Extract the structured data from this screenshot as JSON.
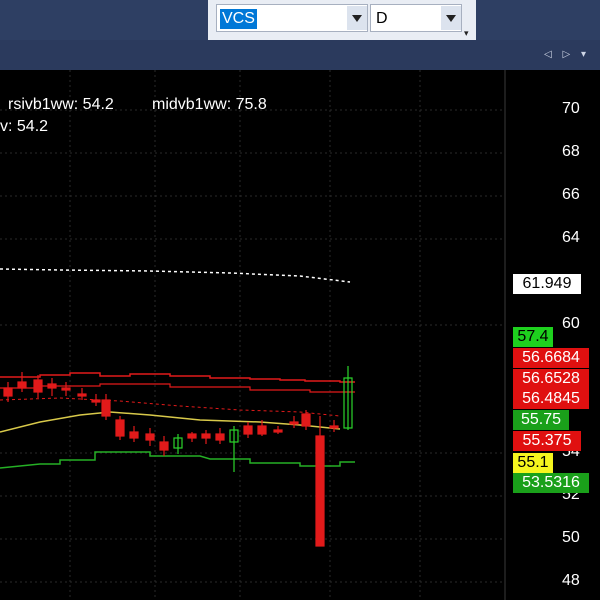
{
  "toolbar": {
    "symbol": "VCS",
    "interval": "D",
    "overflow_icon": "chevron-down-icon"
  },
  "panel": {
    "controls": "◁ ▷ ▾"
  },
  "legend": {
    "rsi": "rsivb1ww: 54.2",
    "mid": "midvb1ww: 75.8",
    "cut": "v: 54.2"
  },
  "axis": {
    "ticks": [
      "70",
      "68",
      "66",
      "64",
      "60",
      "54",
      "52",
      "50",
      "48"
    ]
  },
  "price_tags": [
    {
      "label": "61.949",
      "bg": "#ffffff",
      "fg": "#000000"
    },
    {
      "label": "57.4",
      "bg": "#1ed01e",
      "fg": "#000000"
    },
    {
      "label": "56.6684",
      "bg": "#e01010",
      "fg": "#ffffff"
    },
    {
      "label": "56.6528",
      "bg": "#e01010",
      "fg": "#ffffff"
    },
    {
      "label": "56.4845",
      "bg": "#e01010",
      "fg": "#ffffff"
    },
    {
      "label": "55.75",
      "bg": "#1aa01a",
      "fg": "#ffffff"
    },
    {
      "label": "55.375",
      "bg": "#e01010",
      "fg": "#ffffff"
    },
    {
      "label": "55.1",
      "bg": "#f5f51e",
      "fg": "#000000"
    },
    {
      "label": "53.5316",
      "bg": "#1aa01a",
      "fg": "#ffffff"
    }
  ],
  "colors": {
    "up": "#2bd42b",
    "down": "#e21a1a",
    "band_upper": "#e21a1a",
    "band_lower": "#25b025",
    "mid_line": "#d8c94a",
    "dashed_line": "#ffffff",
    "grid": "#2a2a2a"
  }
}
